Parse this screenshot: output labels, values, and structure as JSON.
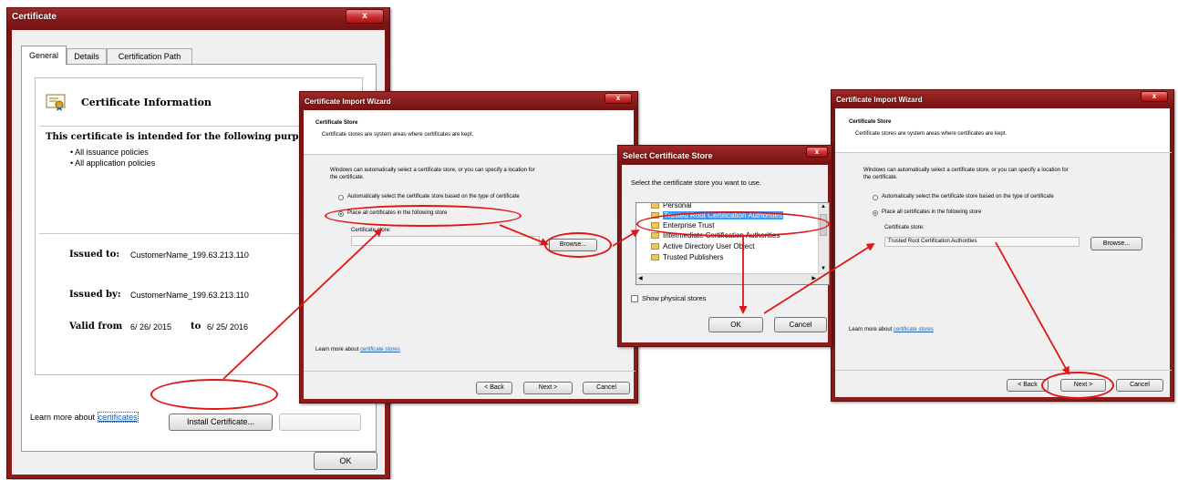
{
  "certificate": {
    "title": "Certificate",
    "close": "x",
    "tabs": [
      "General",
      "Details",
      "Certification Path"
    ],
    "info_title": "Certificate Information",
    "intended": "This certificate is intended for the following purp",
    "purposes": [
      "• All issuance policies",
      "• All application policies"
    ],
    "issued_to_label": "Issued to:",
    "issued_to_value": "CustomerName_199.63.213.110",
    "issued_by_label": "Issued by:",
    "issued_by_value": "CustomerName_199.63.213.110",
    "valid_from_label": "Valid from",
    "valid_from_value": "6/ 26/ 2015",
    "valid_to_label": "to",
    "valid_to_value": "6/ 25/ 2016",
    "install_button": "Install Certificate...",
    "learn_more": "Learn more about",
    "learn_more_link": "certificates",
    "ok_button": "OK"
  },
  "wizard1": {
    "title": "Certificate Import Wizard",
    "close": "x",
    "heading": "Certificate Store",
    "subheading": "Certificate stores are system areas where certificates are kept.",
    "desc_line1": "Windows can automatically select a certificate store, or you can specify a location for",
    "desc_line2": "the certificate.",
    "option_auto": "Automatically select the certificate store based on the type of certificate",
    "option_place": "Place all certificates in the following store",
    "store_label": "Certificate store:",
    "browse_button": "Browse...",
    "learn_more": "Learn more about",
    "learn_more_link": "certificate stores",
    "back_button": "< Back",
    "next_button": "Next >",
    "cancel_button": "Cancel"
  },
  "select_store": {
    "title": "Select Certificate Store",
    "close": "x",
    "prompt": "Select the certificate store you want to use.",
    "items": [
      "Personal",
      "Trusted Root Certification Authorities",
      "Enterprise Trust",
      "Intermediate Certification Authorities",
      "Active Directory User Object",
      "Trusted Publishers"
    ],
    "show_physical": "Show physical stores",
    "ok_button": "OK",
    "cancel_button": "Cancel"
  },
  "wizard2": {
    "title": "Certificate Import Wizard",
    "close": "x",
    "heading": "Certificate Store",
    "subheading": "Certificate stores are system areas where certificates are kept.",
    "desc_line1": "Windows can automatically select a certificate store, or you can specify a location for",
    "desc_line2": "the certificate.",
    "option_auto": "Automatically select the certificate store based on the type of certificate",
    "option_place": "Place all certificates in the following store",
    "store_label": "Certificate store:",
    "store_value": "Trusted Root Certification Authorities",
    "browse_button": "Browse...",
    "learn_more": "Learn more about",
    "learn_more_link": "certificate stores",
    "back_button": "< Back",
    "next_button": "Next >",
    "cancel_button": "Cancel"
  },
  "colors": {
    "annotation": "#e01616",
    "title_bar": "#8c1c1c",
    "selection": "#3399ff",
    "link": "#1a5fb4"
  }
}
